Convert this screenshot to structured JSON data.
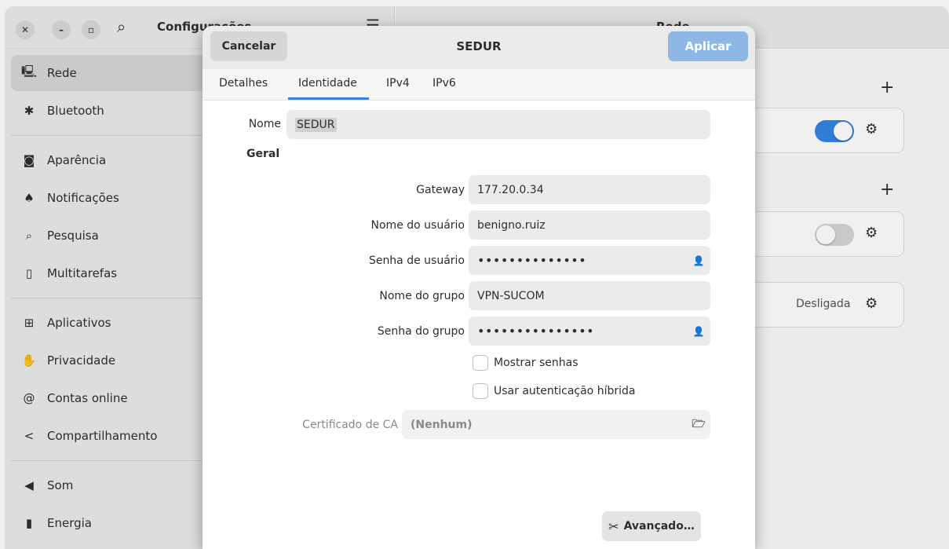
{
  "window": {
    "sidebar_title": "Configurações",
    "content_title": "Rede"
  },
  "sidebar": {
    "items": [
      {
        "label": "Rede",
        "icon": "network-icon"
      },
      {
        "label": "Bluetooth",
        "icon": "bluetooth-icon"
      },
      {
        "label": "Aparência",
        "icon": "appearance-icon"
      },
      {
        "label": "Notificações",
        "icon": "bell-icon"
      },
      {
        "label": "Pesquisa",
        "icon": "search-icon"
      },
      {
        "label": "Multitarefas",
        "icon": "multitask-icon"
      },
      {
        "label": "Aplicativos",
        "icon": "apps-icon"
      },
      {
        "label": "Privacidade",
        "icon": "hand-icon"
      },
      {
        "label": "Contas online",
        "icon": "at-icon"
      },
      {
        "label": "Compartilhamento",
        "icon": "share-icon"
      },
      {
        "label": "Som",
        "icon": "speaker-icon"
      },
      {
        "label": "Energia",
        "icon": "battery-icon"
      }
    ]
  },
  "background_content": {
    "vpn_status": "Desligada"
  },
  "dialog": {
    "title": "SEDUR",
    "cancel_label": "Cancelar",
    "apply_label": "Aplicar",
    "tabs": [
      "Detalhes",
      "Identidade",
      "IPv4",
      "IPv6"
    ],
    "active_tab": "Identidade",
    "name_label": "Nome",
    "name_value": "SEDUR",
    "section_general": "Geral",
    "gateway_label": "Gateway",
    "gateway_value": "177.20.0.34",
    "username_label": "Nome do usuário",
    "username_value": "benigno.ruiz",
    "user_password_label": "Senha de usuário",
    "user_password_value": "••••••••••••••",
    "group_name_label": "Nome do grupo",
    "group_name_value": "VPN-SUCOM",
    "group_password_label": "Senha do grupo",
    "group_password_value": "•••••••••••••••",
    "show_passwords_label": "Mostrar senhas",
    "hybrid_auth_label": "Usar autenticação híbrida",
    "ca_cert_label": "Certificado de CA",
    "ca_cert_value": "(Nenhum)",
    "advanced_label": "Avançado…"
  },
  "colors": {
    "accent": "#3584e4",
    "apply_disabled": "#8fb7e6"
  }
}
